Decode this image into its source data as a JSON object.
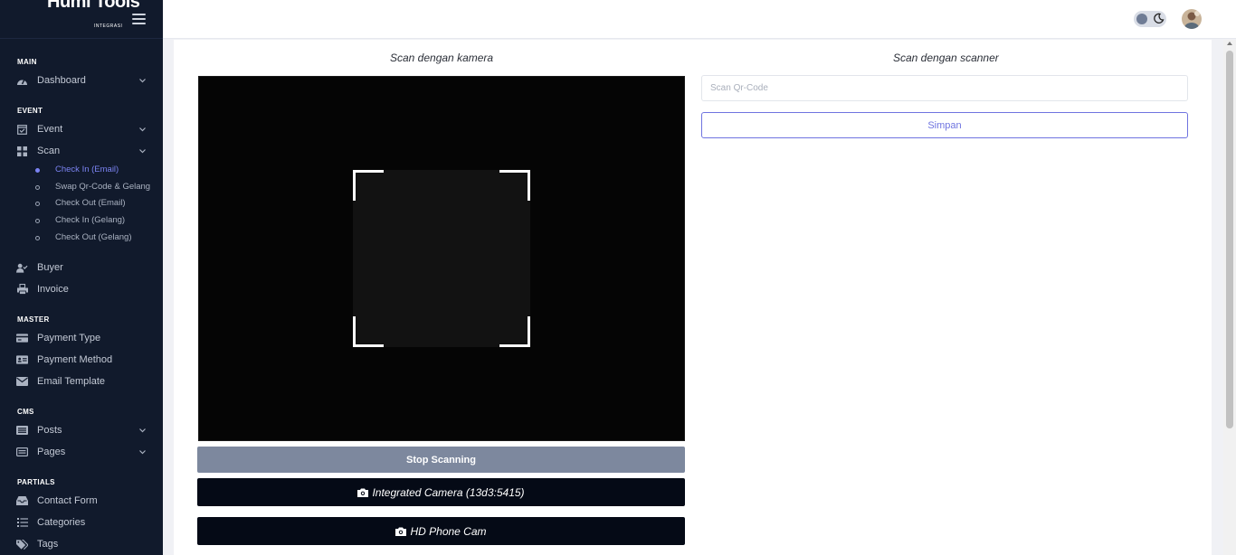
{
  "brand": {
    "name": "Humi Tools",
    "subtitle": "INTEGRASI"
  },
  "sidebar": {
    "sections": [
      "MAIN",
      "EVENT",
      "MASTER",
      "CMS",
      "PARTIALS"
    ],
    "items": [
      {
        "label": "Dashboard",
        "icon": "speedometer-icon"
      },
      {
        "label": "Event",
        "icon": "calendar-check-icon"
      },
      {
        "label": "Scan",
        "icon": "grid-icon"
      },
      {
        "label": "Buyer",
        "icon": "user-check-icon"
      },
      {
        "label": "Invoice",
        "icon": "printer-icon"
      },
      {
        "label": "Payment Type",
        "icon": "credit-card-icon"
      },
      {
        "label": "Payment Method",
        "icon": "id-card-icon"
      },
      {
        "label": "Email Template",
        "icon": "envelope-icon"
      },
      {
        "label": "Posts",
        "icon": "list-icon"
      },
      {
        "label": "Pages",
        "icon": "file-list-icon"
      },
      {
        "label": "Contact Form",
        "icon": "inbox-icon"
      },
      {
        "label": "Categories",
        "icon": "list-bullets-icon"
      },
      {
        "label": "Tags",
        "icon": "tags-icon"
      }
    ],
    "scan_sub": [
      {
        "label": "Check In (Email)",
        "active": true
      },
      {
        "label": "Swap Qr-Code & Gelang",
        "active": false
      },
      {
        "label": "Check Out (Email)",
        "active": false
      },
      {
        "label": "Check In (Gelang)",
        "active": false
      },
      {
        "label": "Check Out (Gelang)",
        "active": false
      }
    ]
  },
  "topbar": {
    "theme_toggle": "moon-icon",
    "avatar": "user-avatar"
  },
  "camera_panel": {
    "title": "Scan dengan kamera",
    "stop_button": "Stop Scanning",
    "cameras": [
      "Integrated Camera (13d3:5415)",
      "HD Phone Cam"
    ]
  },
  "scanner_panel": {
    "title": "Scan dengan scanner",
    "input_placeholder": "Scan Qr-Code",
    "input_value": "",
    "save_button": "Simpan"
  },
  "colors": {
    "sidebar_bg": "#111a2c",
    "accent": "#6f74e0",
    "stop_button_bg": "#7d889e",
    "camera_button_bg": "#050a16"
  }
}
